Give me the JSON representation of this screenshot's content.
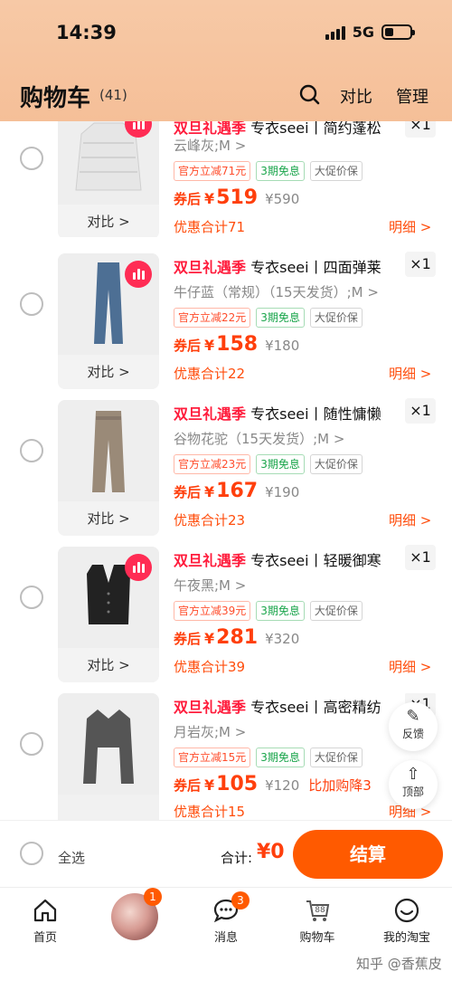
{
  "status_bar": {
    "time": "14:39",
    "network": "5G"
  },
  "header": {
    "title": "购物车",
    "count": "(41)",
    "compare": "对比",
    "manage": "管理"
  },
  "items": [
    {
      "promo": "双旦礼遇季",
      "title": " 专衣seei丨简约蓬松",
      "qty": "×1",
      "variant": "云峰灰;M >",
      "tags": [
        "官方立减71元",
        "3期免息",
        "大促价保"
      ],
      "after_label": "券后",
      "yen": "¥",
      "price": "519",
      "original": "¥590",
      "extra": "",
      "discount": "优惠合计71",
      "detail": "明细 >",
      "compare": "对比 >"
    },
    {
      "promo": "双旦礼遇季",
      "title": " 专衣seei丨四面弹莱",
      "qty": "×1",
      "variant": "牛仔蓝（常规）（15天发货）;M >",
      "tags": [
        "官方立减22元",
        "3期免息",
        "大促价保"
      ],
      "after_label": "券后",
      "yen": "¥",
      "price": "158",
      "original": "¥180",
      "extra": "",
      "discount": "优惠合计22",
      "detail": "明细 >",
      "compare": "对比 >"
    },
    {
      "promo": "双旦礼遇季",
      "title": " 专衣seei丨随性慵懒",
      "qty": "×1",
      "variant": "谷物花驼（15天发货）;M >",
      "tags": [
        "官方立减23元",
        "3期免息",
        "大促价保"
      ],
      "after_label": "券后",
      "yen": "¥",
      "price": "167",
      "original": "¥190",
      "extra": "",
      "discount": "优惠合计23",
      "detail": "明细 >",
      "compare": "对比 >"
    },
    {
      "promo": "双旦礼遇季",
      "title": " 专衣seei丨轻暖御寒",
      "qty": "×1",
      "variant": "午夜黑;M >",
      "tags": [
        "官方立减39元",
        "3期免息",
        "大促价保"
      ],
      "after_label": "券后",
      "yen": "¥",
      "price": "281",
      "original": "¥320",
      "extra": "",
      "discount": "优惠合计39",
      "detail": "明细 >",
      "compare": "对比 >"
    },
    {
      "promo": "双旦礼遇季",
      "title": " 专衣seei丨高密精纺",
      "qty": "×1",
      "variant": "月岩灰;M >",
      "tags": [
        "官方立减15元",
        "3期免息",
        "大促价保"
      ],
      "after_label": "券后",
      "yen": "¥",
      "price": "105",
      "original": "¥120",
      "extra": "比加购降3",
      "discount": "优惠合计15",
      "detail": "明细 >",
      "compare": ""
    }
  ],
  "floating": {
    "feedback": "反馈",
    "top": "顶部"
  },
  "checkout": {
    "select_all": "全选",
    "total_label": "合计:",
    "total_value": "¥0",
    "button": "结算"
  },
  "tabbar": {
    "home": "首页",
    "messages": "消息",
    "messages_badge": "3",
    "cart": "购物车",
    "cart_icon_num": "88",
    "mine": "我的淘宝",
    "avatar_badge": "1"
  },
  "watermark": "知乎 @香蕉皮",
  "colors": {
    "accent": "#ff5a00",
    "promo_red": "#ff1c3c",
    "header_bg": "#f7c9a6"
  }
}
